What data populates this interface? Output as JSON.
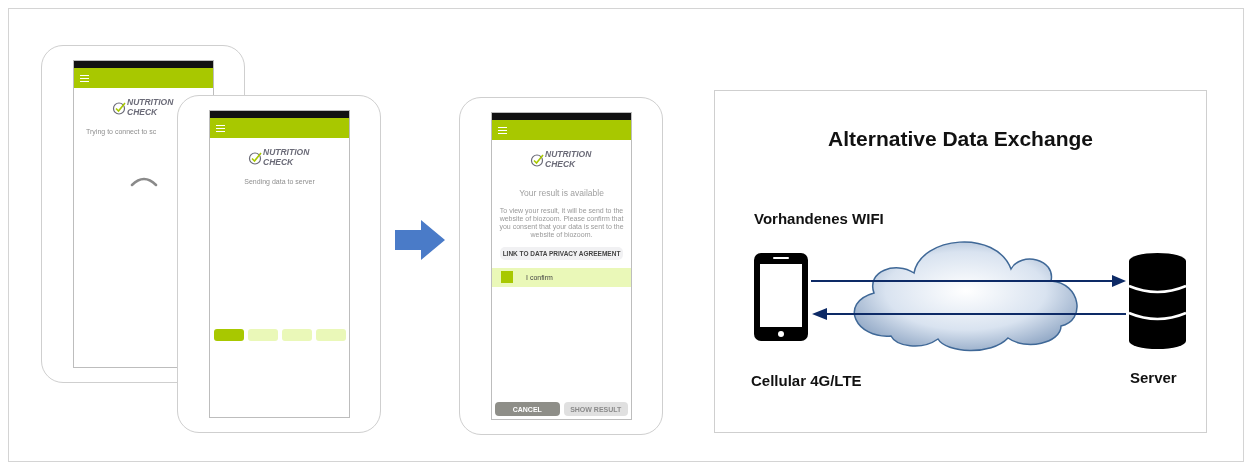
{
  "screens": [
    {
      "kind": "connecting",
      "logo": "NUTRITION CHECK",
      "message": "Trying to connect to sc"
    },
    {
      "kind": "sending",
      "logo": "NUTRITION CHECK",
      "message": "Sending data to server",
      "steps": [
        {
          "active": true
        },
        {
          "active": false
        },
        {
          "active": false
        },
        {
          "active": false
        }
      ]
    },
    {
      "kind": "result",
      "logo": "NUTRITION CHECK",
      "title": "Your result is available",
      "body": "To view your result, it will be send to the website of biozoom. Please confirm that you consent that your data is sent to the website of biozoom.",
      "link": "LINK TO DATA PRIVACY AGREEMENT",
      "confirm": {
        "label": "I confirm",
        "checked": true
      },
      "buttons": [
        {
          "label": "CANCEL",
          "disabled": false
        },
        {
          "label": "SHOW RESULT",
          "disabled": true
        }
      ]
    }
  ],
  "diagram": {
    "title": "Alternative Data Exchange",
    "wifi_label": "Vorhandenes WIFI",
    "cellular_label": "Cellular 4G/LTE",
    "server_label": "Server"
  }
}
